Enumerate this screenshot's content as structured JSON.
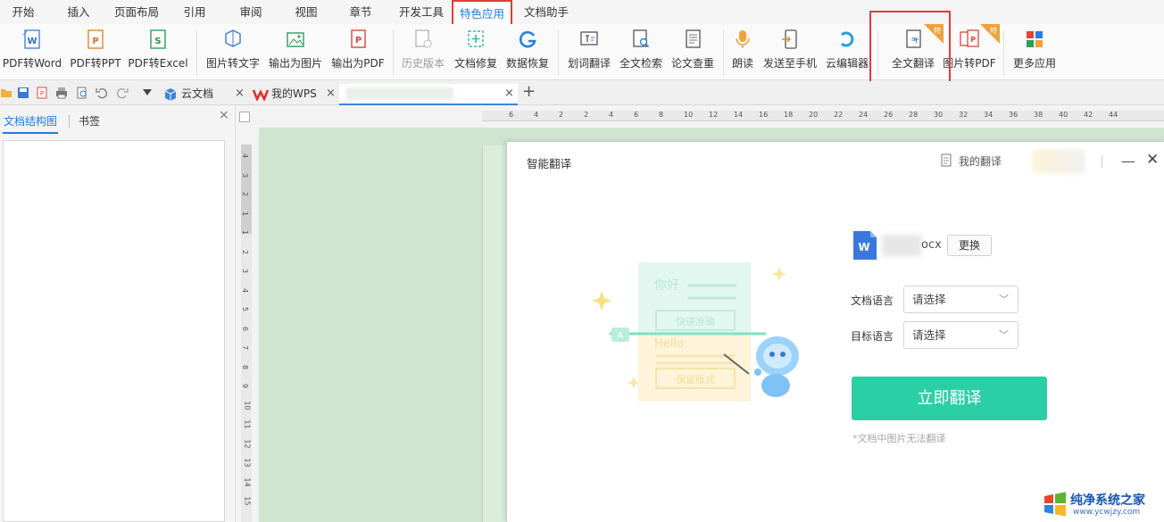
{
  "menu": {
    "tabs": [
      "开始",
      "插入",
      "页面布局",
      "引用",
      "审阅",
      "视图",
      "章节",
      "开发工具",
      "特色应用",
      "文档助手"
    ],
    "active": "特色应用"
  },
  "ribbon": {
    "buttons": [
      "PDF转Word",
      "PDF转PPT",
      "PDF转Excel",
      "图片转文字",
      "输出为图片",
      "输出为PDF",
      "历史版本",
      "文档修复",
      "数据恢复",
      "划词翻译",
      "全文检索",
      "论文查重",
      "朗读",
      "发送至手机",
      "云编辑器",
      "全文翻译",
      "图片转PDF",
      "更多应用"
    ],
    "badge": "特"
  },
  "tabs": {
    "cloud_doc": "云文档",
    "my_wps": "我的WPS",
    "close": "×",
    "add": "+"
  },
  "left_pane": {
    "tab_structure": "文档结构图",
    "tab_bookmark": "书签",
    "close": "×"
  },
  "ruler": {
    "h_ticks": [
      "6",
      "4",
      "2",
      "2",
      "4",
      "6",
      "8",
      "10",
      "12",
      "14",
      "16",
      "18",
      "20",
      "22",
      "24",
      "26",
      "28",
      "30",
      "32",
      "34",
      "36",
      "38",
      "40",
      "42",
      "44"
    ],
    "v_ticks": [
      "4",
      "3",
      "2",
      "1",
      "1",
      "2",
      "3",
      "4",
      "5",
      "6",
      "7",
      "8",
      "9",
      "10",
      "11",
      "12",
      "13",
      "14",
      "15"
    ]
  },
  "dialog": {
    "title": "智能翻译",
    "my_translation": "我的翻译",
    "minimize": "—",
    "close": "✕",
    "file_suffix": "ocx",
    "change": "更换",
    "source_lang_label": "文档语言",
    "target_lang_label": "目标语言",
    "select_placeholder": "请选择",
    "translate_button": "立即翻译",
    "note": "*文档中图片无法翻译",
    "illustration": {
      "hello_cn": "你好",
      "fast_accurate": "快速准确",
      "hello_en": "Hello",
      "keep_format": "保留版式"
    }
  },
  "watermark": {
    "title": "纯净系统之家",
    "url": "www.ycwjzy.com"
  },
  "colors": {
    "accent": "#1e7ae0",
    "highlight": "#e03b3b",
    "primary_button": "#2bcfa5",
    "doc_background": "#cfe5cf"
  }
}
